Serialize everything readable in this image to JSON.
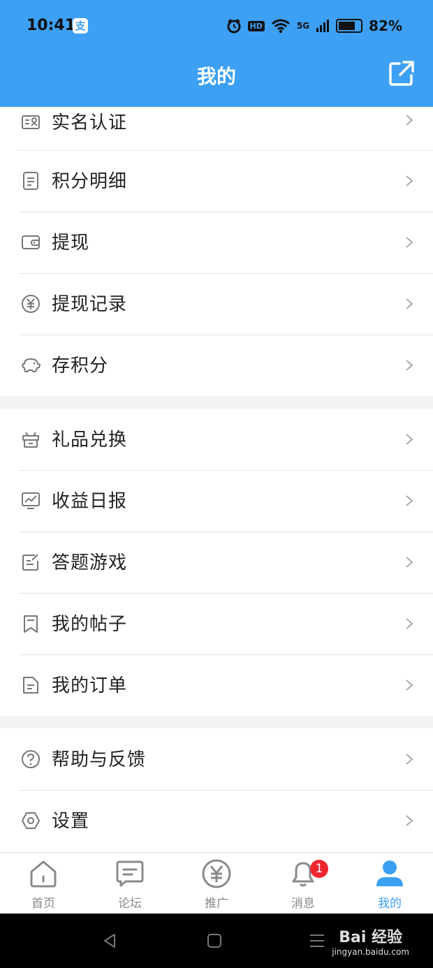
{
  "status_bar": {
    "time": "10:41",
    "alipay_glyph": "支",
    "hd": "HD",
    "network": "5G",
    "battery": "82%",
    "battery_level": 0.82
  },
  "header": {
    "title": "我的",
    "share_icon": "share-external-icon"
  },
  "menu_groups": [
    {
      "items": [
        {
          "label": "实名认证",
          "icon": "id-card-icon"
        },
        {
          "label": "积分明细",
          "icon": "document-icon"
        },
        {
          "label": "提现",
          "icon": "wallet-icon"
        },
        {
          "label": "提现记录",
          "icon": "yen-circle-icon"
        },
        {
          "label": "存积分",
          "icon": "piggy-bank-icon"
        }
      ]
    },
    {
      "items": [
        {
          "label": "礼品兑换",
          "icon": "gift-icon"
        },
        {
          "label": "收益日报",
          "icon": "chart-monitor-icon"
        },
        {
          "label": "答题游戏",
          "icon": "edit-note-icon"
        },
        {
          "label": "我的帖子",
          "icon": "bookmark-icon"
        },
        {
          "label": "我的订单",
          "icon": "order-doc-icon"
        }
      ]
    },
    {
      "items": [
        {
          "label": "帮助与反馈",
          "icon": "help-circle-icon"
        },
        {
          "label": "设置",
          "icon": "settings-hexagon-icon"
        }
      ]
    }
  ],
  "tabbar": {
    "tabs": [
      {
        "label": "首页",
        "icon": "home-icon",
        "active": false
      },
      {
        "label": "论坛",
        "icon": "chat-bubble-icon",
        "active": false
      },
      {
        "label": "推广",
        "icon": "yen-coin-icon",
        "active": false
      },
      {
        "label": "消息",
        "icon": "bell-icon",
        "active": false,
        "badge": "1"
      },
      {
        "label": "我的",
        "icon": "user-icon",
        "active": true
      }
    ]
  },
  "watermark": {
    "brand": "Bai 经验",
    "domain": "jingyan.baidu.com"
  },
  "colors": {
    "primary": "#3da0f5",
    "badge": "#f0262f",
    "text": "#222222"
  }
}
